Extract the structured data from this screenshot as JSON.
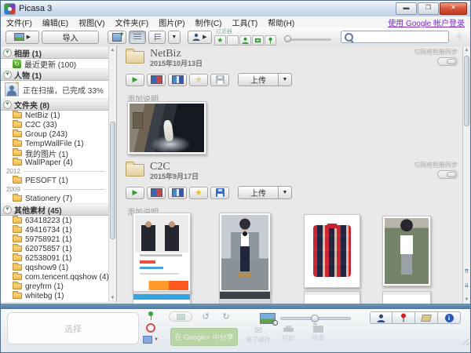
{
  "window": {
    "title": "Picasa 3"
  },
  "menubar": {
    "items": [
      "文件(F)",
      "编辑(E)",
      "视图(V)",
      "文件夹(F)",
      "图片(P)",
      "制作(C)",
      "工具(T)",
      "帮助(H)"
    ],
    "login_link": "使用 Google 帐户登录"
  },
  "toolbar": {
    "import_label": "导入",
    "filter_label": "过滤器"
  },
  "sidebar": {
    "albums_header": "相册 (1)",
    "recent_item": "最近更新 (100)",
    "people_header": "人物 (1)",
    "people_status": "正在扫描，已完成 33%",
    "folders_header": "文件夹 (8)",
    "folders": [
      "NetBiz (1)",
      "C2C (33)",
      "Group (243)",
      "TempWallFile (1)",
      "我的图片 (1)",
      "WallPaper (4)"
    ],
    "year_2012": "2012",
    "folders_2012": [
      "PESOFT (1)"
    ],
    "year_2009": "2009",
    "folders_2009": [
      "Stationery (7)"
    ],
    "other_header": "其他素材 (45)",
    "other_folders": [
      "63418223 (1)",
      "49416734 (1)",
      "59758921 (1)",
      "62075857 (1)",
      "62538091 (1)",
      "qqshow9 (1)",
      "com.tencent.qqshow (4)",
      "greyfrm (1)",
      "whitebg (1)"
    ]
  },
  "main": {
    "sync_label": "与网络相册同步",
    "albums": [
      {
        "title": "NetBiz",
        "date": "2015年10月13日",
        "upload": "上传",
        "caption": "添加说明"
      },
      {
        "title": "C2C",
        "date": "2015年9月17日",
        "upload": "上传",
        "caption": "添加说明"
      }
    ]
  },
  "bottom": {
    "tray_label": "选择",
    "share_button": "在 Google+ 中分享",
    "email_label": "电子邮件",
    "print_label": "打印",
    "export_label": "导出"
  },
  "colors": {
    "accent_blue": "#4a7ba5",
    "share_green": "#b9d5a5",
    "link_purple": "#7a2fbf"
  }
}
